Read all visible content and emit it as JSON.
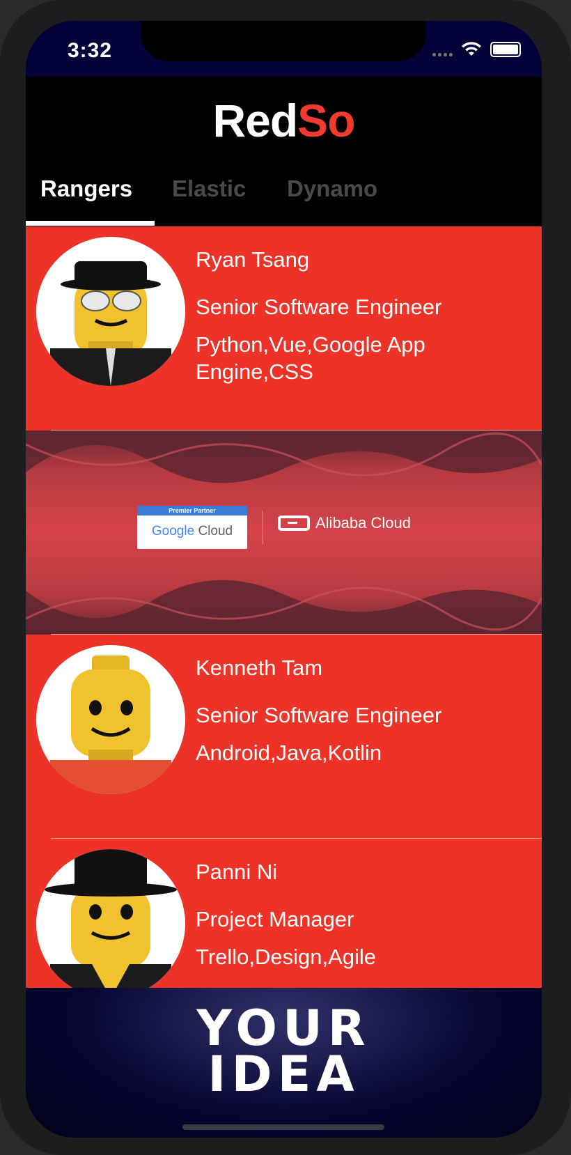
{
  "status": {
    "time": "3:32"
  },
  "app": {
    "brand_part1": "Red",
    "brand_part2": "So"
  },
  "tabs": [
    {
      "label": "Rangers",
      "active": true
    },
    {
      "label": "Elastic",
      "active": false
    },
    {
      "label": "Dynamo",
      "active": false
    }
  ],
  "people": [
    {
      "name": "Ryan Tsang",
      "role": "Senior Software Engineer",
      "skills": "Python,Vue,Google App Engine,CSS"
    },
    {
      "name": "Kenneth Tam",
      "role": "Senior Software Engineer",
      "skills": "Android,Java,Kotlin"
    },
    {
      "name": "Panni Ni",
      "role": "Project Manager",
      "skills": "Trello,Design,Agile"
    }
  ],
  "banner": {
    "badge_header": "Premier Partner",
    "google_word": "Google",
    "cloud_word": "Cloud",
    "alibaba": "Alibaba Cloud"
  },
  "footer": {
    "line1": "YOUR",
    "line2": "IDEA"
  },
  "colors": {
    "accent": "#ed3327",
    "brand_red": "#f23a2e",
    "status_bg": "#03033a"
  }
}
